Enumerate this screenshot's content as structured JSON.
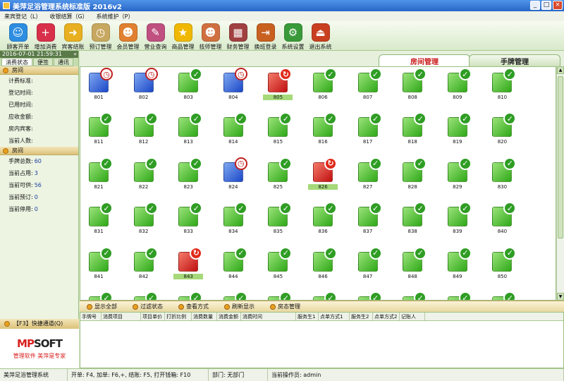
{
  "window": {
    "title": "美萍足浴管理系统标准版 2016v2",
    "min": "_",
    "max": "□",
    "close": "×"
  },
  "menu": [
    "来宾登记（L）",
    "收银结算（G）",
    "系统维护（P）"
  ],
  "toolbar": [
    {
      "label": "顾客开单",
      "icon": "customer-icon",
      "color": "#2d8de0",
      "glyph": "☺"
    },
    {
      "label": "增加消费",
      "icon": "add-cross-icon",
      "color": "#d8304a",
      "glyph": "+"
    },
    {
      "label": "宾客结账",
      "icon": "arrow-right-icon",
      "color": "#e8b020",
      "glyph": "➜"
    },
    {
      "label": "预订管理",
      "icon": "clock-icon",
      "color": "#c8a860",
      "glyph": "◷"
    },
    {
      "label": "会员管理",
      "icon": "users-icon",
      "color": "#e08030",
      "glyph": "☻"
    },
    {
      "label": "营业查询",
      "icon": "pencil-icon",
      "color": "#c05080",
      "glyph": "✎"
    },
    {
      "label": "商品管理",
      "icon": "star-icon",
      "color": "#f0b800",
      "glyph": "★"
    },
    {
      "label": "技师管理",
      "icon": "staff-icon",
      "color": "#d07040",
      "glyph": "☻"
    },
    {
      "label": "财务管理",
      "icon": "calculator-icon",
      "color": "#a04040",
      "glyph": "▦"
    },
    {
      "label": "换班登录",
      "icon": "exit-door-icon",
      "color": "#c86020",
      "glyph": "⇥"
    },
    {
      "label": "系统设置",
      "icon": "gear-icon",
      "color": "#3a9a3a",
      "glyph": "⚙"
    },
    {
      "label": "退出系统",
      "icon": "exit-icon",
      "color": "#c84020",
      "glyph": "⏏"
    }
  ],
  "sidebar": {
    "datetime": "2016-07-01  21:59:31",
    "collapse": "«",
    "tabs": [
      "消费状态",
      "便签",
      "通讯"
    ],
    "room_section": "房间",
    "room_fields": [
      {
        "label": "计费标准:",
        "value": ""
      },
      {
        "label": "登记时间:",
        "value": ""
      },
      {
        "label": "已用时间:",
        "value": ""
      },
      {
        "label": "应收金额:",
        "value": ""
      },
      {
        "label": "房内宾客:",
        "value": ""
      },
      {
        "label": "当前人数:",
        "value": ""
      }
    ],
    "stats_section": "房间",
    "stats": [
      {
        "label": "手牌总数:",
        "value": "60"
      },
      {
        "label": "当前占用:",
        "value": "3"
      },
      {
        "label": "当前可供:",
        "value": "56"
      },
      {
        "label": "当前预订:",
        "value": "0"
      },
      {
        "label": "当前停用:",
        "value": "0"
      }
    ],
    "quick_channel": "【F3】快捷通道(Q)",
    "brand_logo_m": "MP",
    "brand_logo_rest": "SOFT",
    "brand_slogan": "管理软件  美萍是专家"
  },
  "tabs": {
    "active": "房间管理",
    "inactive": "手牌管理"
  },
  "rooms": [
    {
      "num": "801",
      "status": "booked"
    },
    {
      "num": "802",
      "status": "booked"
    },
    {
      "num": "803",
      "status": "free"
    },
    {
      "num": "804",
      "status": "booked"
    },
    {
      "num": "805",
      "status": "occupied"
    },
    {
      "num": "806",
      "status": "free"
    },
    {
      "num": "807",
      "status": "free"
    },
    {
      "num": "808",
      "status": "free"
    },
    {
      "num": "809",
      "status": "free"
    },
    {
      "num": "810",
      "status": "free"
    },
    {
      "num": "811",
      "status": "free"
    },
    {
      "num": "812",
      "status": "free"
    },
    {
      "num": "813",
      "status": "free"
    },
    {
      "num": "814",
      "status": "free"
    },
    {
      "num": "815",
      "status": "free"
    },
    {
      "num": "816",
      "status": "free"
    },
    {
      "num": "817",
      "status": "free"
    },
    {
      "num": "818",
      "status": "free"
    },
    {
      "num": "819",
      "status": "free"
    },
    {
      "num": "820",
      "status": "free"
    },
    {
      "num": "821",
      "status": "free"
    },
    {
      "num": "822",
      "status": "free"
    },
    {
      "num": "823",
      "status": "free"
    },
    {
      "num": "824",
      "status": "booked"
    },
    {
      "num": "825",
      "status": "free"
    },
    {
      "num": "826",
      "status": "occupied"
    },
    {
      "num": "827",
      "status": "free"
    },
    {
      "num": "828",
      "status": "free"
    },
    {
      "num": "829",
      "status": "free"
    },
    {
      "num": "830",
      "status": "free"
    },
    {
      "num": "831",
      "status": "free"
    },
    {
      "num": "832",
      "status": "free"
    },
    {
      "num": "833",
      "status": "free"
    },
    {
      "num": "834",
      "status": "free"
    },
    {
      "num": "835",
      "status": "free"
    },
    {
      "num": "836",
      "status": "free"
    },
    {
      "num": "837",
      "status": "free"
    },
    {
      "num": "838",
      "status": "free"
    },
    {
      "num": "839",
      "status": "free"
    },
    {
      "num": "840",
      "status": "free"
    },
    {
      "num": "841",
      "status": "free"
    },
    {
      "num": "842",
      "status": "free"
    },
    {
      "num": "843",
      "status": "occupied"
    },
    {
      "num": "844",
      "status": "free"
    },
    {
      "num": "845",
      "status": "free"
    },
    {
      "num": "846",
      "status": "free"
    },
    {
      "num": "847",
      "status": "free"
    },
    {
      "num": "848",
      "status": "free"
    },
    {
      "num": "849",
      "status": "free"
    },
    {
      "num": "850",
      "status": "free"
    },
    {
      "num": "",
      "status": "free"
    },
    {
      "num": "",
      "status": "free"
    },
    {
      "num": "",
      "status": "free"
    },
    {
      "num": "",
      "status": "free"
    },
    {
      "num": "",
      "status": "free"
    },
    {
      "num": "",
      "status": "free"
    },
    {
      "num": "",
      "status": "free"
    },
    {
      "num": "",
      "status": "free"
    },
    {
      "num": "",
      "status": "free"
    },
    {
      "num": "",
      "status": "free"
    }
  ],
  "actions": [
    "显示全部",
    "过滤状态",
    "查看方式",
    "刷新显示",
    "房态管理"
  ],
  "table_headers": [
    "手牌号",
    "消费项目",
    "项目单价",
    "打折比例",
    "消费数量",
    "消费金额",
    "消费时间",
    "服务生1",
    "点单方式1",
    "服务生2",
    "点单方式2",
    "记账人"
  ],
  "status": {
    "app": "美萍足浴管理系统",
    "keys": "开单: F4, 加单: F6,+, 结账: F5, 打开钱箱: F10",
    "dept": "部门: 无部门",
    "operator": "当前操作员: admin"
  }
}
